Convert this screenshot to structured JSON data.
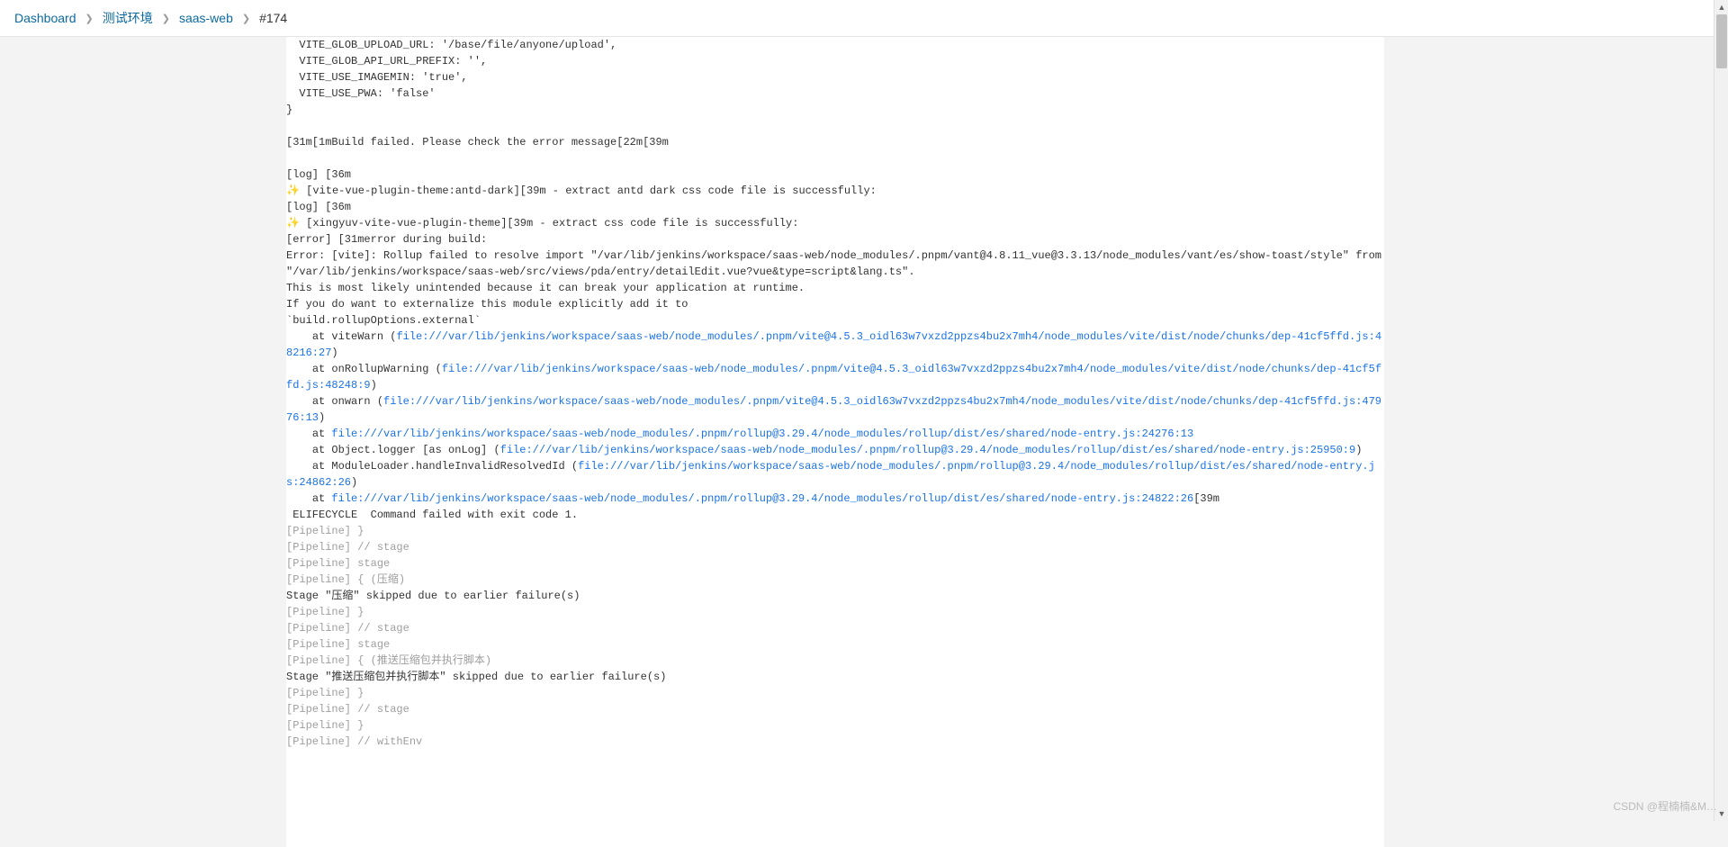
{
  "breadcrumbs": {
    "items": [
      {
        "label": "Dashboard"
      },
      {
        "label": "测试环境"
      },
      {
        "label": "saas-web"
      },
      {
        "label": "#174"
      }
    ]
  },
  "console": {
    "lines": [
      {
        "kind": "text",
        "text": "  VITE_GLOB_UPLOAD_URL: '/base/file/anyone/upload',"
      },
      {
        "kind": "text",
        "text": "  VITE_GLOB_API_URL_PREFIX: '',"
      },
      {
        "kind": "text",
        "text": "  VITE_USE_IMAGEMIN: 'true',"
      },
      {
        "kind": "text",
        "text": "  VITE_USE_PWA: 'false'"
      },
      {
        "kind": "text",
        "text": "}"
      },
      {
        "kind": "blank",
        "text": ""
      },
      {
        "kind": "text",
        "text": "\u001b[31m\u001b[1mBuild failed. Please check the error message\u001b[22m\u001b[39m"
      },
      {
        "kind": "blank",
        "text": ""
      },
      {
        "kind": "text",
        "text": "[log] \u001b[36m"
      },
      {
        "kind": "emoji-text",
        "emoji": "✨",
        "text": " [vite-vue-plugin-theme:antd-dark]\u001b[39m - extract antd dark css code file is successfully:"
      },
      {
        "kind": "text",
        "text": "[log] \u001b[36m"
      },
      {
        "kind": "emoji-text",
        "emoji": "✨",
        "text": " [xingyuv-vite-vue-plugin-theme]\u001b[39m - extract css code file is successfully:"
      },
      {
        "kind": "text",
        "text": "[error] \u001b[31merror during build:"
      },
      {
        "kind": "text",
        "text": "Error: [vite]: Rollup failed to resolve import \"/var/lib/jenkins/workspace/saas-web/node_modules/.pnpm/vant@4.8.11_vue@3.3.13/node_modules/vant/es/show-toast/style\" from \"/var/lib/jenkins/workspace/saas-web/src/views/pda/entry/detailEdit.vue?vue&type=script&lang.ts\"."
      },
      {
        "kind": "text",
        "text": "This is most likely unintended because it can break your application at runtime."
      },
      {
        "kind": "text",
        "text": "If you do want to externalize this module explicitly add it to"
      },
      {
        "kind": "text",
        "text": "`build.rollupOptions.external`"
      },
      {
        "kind": "stack",
        "prefix": "    at viteWarn (",
        "link": "file:///var/lib/jenkins/workspace/saas-web/node_modules/.pnpm/vite@4.5.3_oidl63w7vxzd2ppzs4bu2x7mh4/node_modules/vite/dist/node/chunks/dep-41cf5ffd.js:48216:27",
        "suffix": ")"
      },
      {
        "kind": "stack",
        "prefix": "    at onRollupWarning (",
        "link": "file:///var/lib/jenkins/workspace/saas-web/node_modules/.pnpm/vite@4.5.3_oidl63w7vxzd2ppzs4bu2x7mh4/node_modules/vite/dist/node/chunks/dep-41cf5ffd.js:48248:9",
        "suffix": ")"
      },
      {
        "kind": "stack",
        "prefix": "    at onwarn (",
        "link": "file:///var/lib/jenkins/workspace/saas-web/node_modules/.pnpm/vite@4.5.3_oidl63w7vxzd2ppzs4bu2x7mh4/node_modules/vite/dist/node/chunks/dep-41cf5ffd.js:47976:13",
        "suffix": ")"
      },
      {
        "kind": "stack",
        "prefix": "    at ",
        "link": "file:///var/lib/jenkins/workspace/saas-web/node_modules/.pnpm/rollup@3.29.4/node_modules/rollup/dist/es/shared/node-entry.js:24276:13",
        "suffix": ""
      },
      {
        "kind": "stack",
        "prefix": "    at Object.logger [as onLog] (",
        "link": "file:///var/lib/jenkins/workspace/saas-web/node_modules/.pnpm/rollup@3.29.4/node_modules/rollup/dist/es/shared/node-entry.js:25950:9",
        "suffix": ")"
      },
      {
        "kind": "stack",
        "prefix": "    at ModuleLoader.handleInvalidResolvedId (",
        "link": "file:///var/lib/jenkins/workspace/saas-web/node_modules/.pnpm/rollup@3.29.4/node_modules/rollup/dist/es/shared/node-entry.js:24862:26",
        "suffix": ")"
      },
      {
        "kind": "stack",
        "prefix": "    at ",
        "link": "file:///var/lib/jenkins/workspace/saas-web/node_modules/.pnpm/rollup@3.29.4/node_modules/rollup/dist/es/shared/node-entry.js:24822:26",
        "suffix": "\u001b[39m"
      },
      {
        "kind": "text",
        "text": " ELIFECYCLE  Command failed with exit code 1."
      },
      {
        "kind": "dim",
        "text": "[Pipeline] }"
      },
      {
        "kind": "dim",
        "text": "[Pipeline] // stage"
      },
      {
        "kind": "dim",
        "text": "[Pipeline] stage"
      },
      {
        "kind": "dim",
        "text": "[Pipeline] { (压缩)"
      },
      {
        "kind": "text",
        "text": "Stage \"压缩\" skipped due to earlier failure(s)"
      },
      {
        "kind": "dim",
        "text": "[Pipeline] }"
      },
      {
        "kind": "dim",
        "text": "[Pipeline] // stage"
      },
      {
        "kind": "dim",
        "text": "[Pipeline] stage"
      },
      {
        "kind": "dim",
        "text": "[Pipeline] { (推送压缩包并执行脚本)"
      },
      {
        "kind": "text",
        "text": "Stage \"推送压缩包并执行脚本\" skipped due to earlier failure(s)"
      },
      {
        "kind": "dim",
        "text": "[Pipeline] }"
      },
      {
        "kind": "dim",
        "text": "[Pipeline] // stage"
      },
      {
        "kind": "dim",
        "text": "[Pipeline] }"
      },
      {
        "kind": "dim",
        "text": "[Pipeline] // withEnv"
      }
    ]
  },
  "watermark": "CSDN @程楠楠&M…",
  "escape_char": "\u001b"
}
